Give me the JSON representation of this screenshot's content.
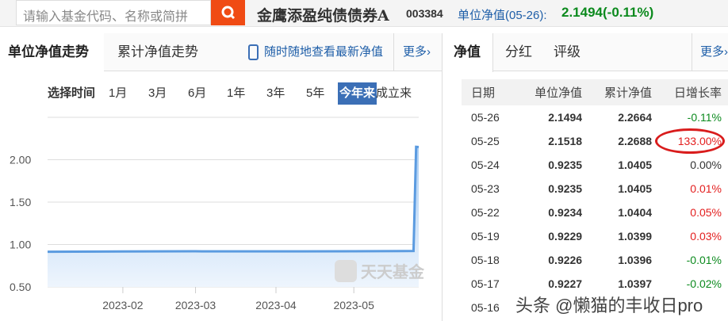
{
  "header": {
    "search_placeholder": "请输入基金代码、名称或简拼",
    "fund_name": "金鹰添盈纯债债券A",
    "fund_code": "003384",
    "nav_label": "单位净值(05-26):",
    "nav_value": "2.1494(-0.11%)"
  },
  "left": {
    "tabs": [
      "单位净值走势",
      "累计净值走势"
    ],
    "promo": "随时随地查看最新净值",
    "more": "更多›",
    "time_label": "选择时间",
    "ranges": [
      "1月",
      "3月",
      "6月",
      "1年",
      "3年",
      "5年",
      "今年来",
      "成立来"
    ],
    "selected_range": "今年来",
    "watermark": "天天基金"
  },
  "right": {
    "tabs": [
      "净值",
      "分红",
      "评级"
    ],
    "more": "更多›",
    "columns": [
      "日期",
      "单位净值",
      "累计净值",
      "日增长率"
    ],
    "rows": [
      {
        "date": "05-26",
        "nav": "2.1494",
        "acc": "2.2664",
        "chg": "-0.11%",
        "dir": "down"
      },
      {
        "date": "05-25",
        "nav": "2.1518",
        "acc": "2.2688",
        "chg": "133.00%",
        "dir": "up"
      },
      {
        "date": "05-24",
        "nav": "0.9235",
        "acc": "1.0405",
        "chg": "0.00%",
        "dir": "flat"
      },
      {
        "date": "05-23",
        "nav": "0.9235",
        "acc": "1.0405",
        "chg": "0.01%",
        "dir": "up"
      },
      {
        "date": "05-22",
        "nav": "0.9234",
        "acc": "1.0404",
        "chg": "0.05%",
        "dir": "up"
      },
      {
        "date": "05-19",
        "nav": "0.9229",
        "acc": "1.0399",
        "chg": "0.03%",
        "dir": "up"
      },
      {
        "date": "05-18",
        "nav": "0.9226",
        "acc": "1.0396",
        "chg": "-0.01%",
        "dir": "down"
      },
      {
        "date": "05-17",
        "nav": "0.9227",
        "acc": "1.0397",
        "chg": "-0.02%",
        "dir": "down"
      },
      {
        "date": "05-16",
        "nav": "",
        "acc": "",
        "chg": "",
        "dir": "flat"
      }
    ]
  },
  "watermark_text": "头条 @懒猫的丰收日pro",
  "chart_data": {
    "type": "area",
    "title": "",
    "xlabel": "",
    "ylabel": "",
    "ylim": [
      0.5,
      2.5
    ],
    "yticks": [
      "0.50",
      "1.00",
      "1.50",
      "2.00"
    ],
    "xticks": [
      "2023-02",
      "2023-03",
      "2023-04",
      "2023-05"
    ],
    "x": [
      "2023-01-03",
      "2023-02-01",
      "2023-03-01",
      "2023-04-01",
      "2023-05-01",
      "2023-05-24",
      "2023-05-25",
      "2023-05-26"
    ],
    "values": [
      0.915,
      0.918,
      0.92,
      0.919,
      0.921,
      0.9235,
      2.1518,
      2.1494
    ],
    "color": "#5b9be0"
  }
}
